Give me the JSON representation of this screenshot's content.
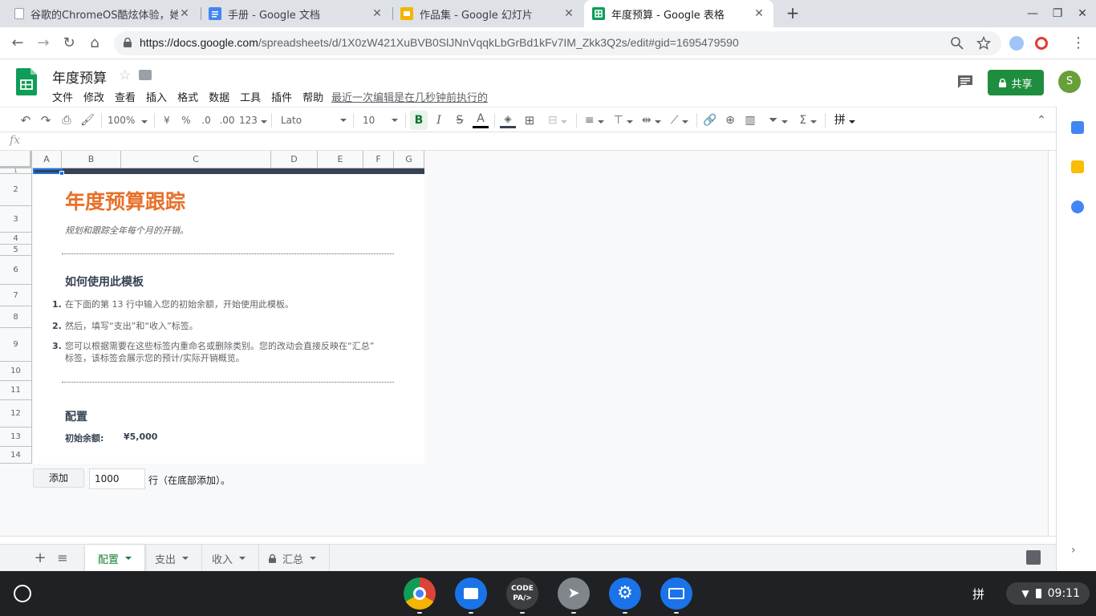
{
  "browser": {
    "tabs": [
      {
        "title": "谷歌的ChromeOS酷炫体验，她",
        "favicon": "page-icon"
      },
      {
        "title": "手册 - Google 文档",
        "favicon": "docs-icon"
      },
      {
        "title": "作品集 - Google 幻灯片",
        "favicon": "slides-icon"
      },
      {
        "title": "年度预算 - Google 表格",
        "favicon": "sheets-icon"
      }
    ],
    "url_host": "https://docs.google.com",
    "url_path": "/spreadsheets/d/1X0zW421XuBVB0SlJNnVqqkLbGrBd1kFv7IM_Zkk3Q2s/edit#gid=1695479590"
  },
  "sheets": {
    "doc_title": "年度预算",
    "menu": [
      "文件",
      "修改",
      "查看",
      "插入",
      "格式",
      "数据",
      "工具",
      "插件",
      "帮助"
    ],
    "last_edit": "最近一次编辑是在几秒钟前执行的",
    "share_label": "共享",
    "avatar_letter": "S"
  },
  "toolbar": {
    "zoom": "100%",
    "currency": "¥",
    "percent": "%",
    "dec_less": ".0",
    "dec_more": ".00",
    "format": "123",
    "font": "Lato",
    "font_size": "10",
    "bold": "B",
    "italic": "I",
    "strike": "S",
    "text_color": "A",
    "ime_btn": "拼"
  },
  "formula_bar": {
    "fx": "fx"
  },
  "grid": {
    "columns": [
      "A",
      "B",
      "C",
      "D",
      "E",
      "F",
      "G"
    ],
    "rows": [
      "1",
      "2",
      "3",
      "4",
      "5",
      "6",
      "7",
      "8",
      "9",
      "10",
      "11",
      "12",
      "13",
      "14"
    ]
  },
  "content": {
    "title": "年度预算跟踪",
    "subtitle": "规划和跟踪全年每个月的开销。",
    "howto_heading": "如何使用此模板",
    "steps": [
      {
        "num": "1.",
        "text": "在下面的第 13 行中输入您的初始余额，开始使用此模板。"
      },
      {
        "num": "2.",
        "text": "然后，填写“支出”和“收入”标签。"
      },
      {
        "num": "3.",
        "text": "您可以根据需要在这些标签内重命名或删除类别。您的改动会直接反映在“汇总”",
        "text2": "标签，该标签会展示您的预计/实际开销概览。"
      }
    ],
    "config_heading": "配置",
    "config_label": "初始余额:",
    "config_value": "¥5,000"
  },
  "add_rows": {
    "button": "添加",
    "value": "1000",
    "suffix": "行（在底部添加）。"
  },
  "sheet_tabs": [
    {
      "label": "配置",
      "active": true
    },
    {
      "label": "支出",
      "active": false
    },
    {
      "label": "收入",
      "active": false
    },
    {
      "label": "汇总",
      "active": false,
      "locked": true
    }
  ],
  "shelf": {
    "ime": "拼",
    "time": "09:11"
  },
  "colors": {
    "sheets_green": "#1e8e3e",
    "title_orange": "#e8702a",
    "heading_navy": "#374253"
  }
}
